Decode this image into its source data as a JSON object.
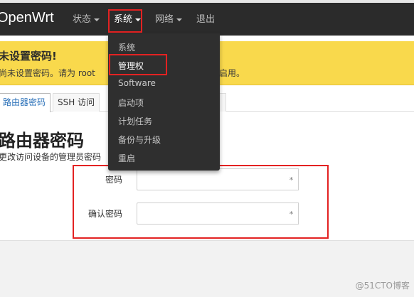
{
  "navbar": {
    "brand": "OpenWrt",
    "items": [
      {
        "label": "状态"
      },
      {
        "label": "系统"
      },
      {
        "label": "网络"
      },
      {
        "label": "退出"
      }
    ]
  },
  "alert": {
    "title": "未设置密码!",
    "text": "尚未设置密码。请为 root",
    "text_tail": "启用。"
  },
  "tabs": [
    {
      "label": "路由器密码"
    },
    {
      "label": "SSH 访问"
    }
  ],
  "page": {
    "title": "路由器密码",
    "description": "更改访问设备的管理员密码"
  },
  "form": {
    "password_label": "密码",
    "confirm_label": "确认密码",
    "password_value": "",
    "confirm_value": "",
    "reveal_symbol": "*"
  },
  "dropdown": {
    "items": [
      {
        "label": "系统"
      },
      {
        "label": "管理权"
      },
      {
        "label": "Software"
      },
      {
        "label": "启动项"
      },
      {
        "label": "计划任务"
      },
      {
        "label": "备份与升级"
      },
      {
        "label": "重启"
      }
    ]
  },
  "watermark": "@51CTO博客",
  "colors": {
    "navbar_bg": "#2b2b2b",
    "alert_bg": "#f9d94c",
    "highlight_red": "#e32222",
    "active_tab_text": "#2a70b8"
  }
}
